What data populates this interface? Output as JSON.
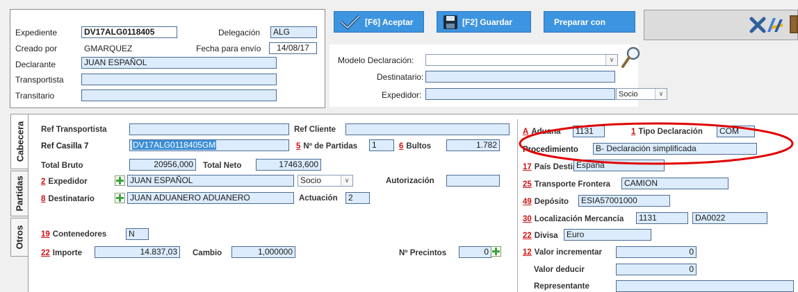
{
  "header": {
    "expediente_label": "Expediente",
    "expediente_value": "DV17ALG0118405",
    "delegacion_label": "Delegación",
    "delegacion_value": "ALG",
    "creado_label": "Creado por",
    "creado_value": "GMARQUEZ",
    "fecha_envio_label": "Fecha para envío",
    "fecha_envio_value": "14/08/17",
    "declarante_label": "Declarante",
    "declarante_value": "JUAN ESPAÑOL",
    "transportista_label": "Transportista",
    "transportista_value": "",
    "transitario_label": "Transitario",
    "transitario_value": ""
  },
  "toolbar": {
    "aceptar_label": "[F6] Aceptar",
    "guardar_label": "[F2] Guardar",
    "preparar_label": "Preparar con"
  },
  "modelo": {
    "modelo_label": "Modelo Declaración:",
    "modelo_value": "",
    "destinatario_label": "Destinatario:",
    "destinatario_value": "",
    "expedidor_label": "Expedidor:",
    "expedidor_value": "",
    "socio_value": "Socio"
  },
  "tabs": [
    "Cabecera",
    "Partidas",
    "Otros"
  ],
  "cabecera": {
    "ref_transportista_label": "Ref Transportista",
    "ref_transportista_value": "",
    "ref_cliente_label": "Ref Cliente",
    "ref_cliente_value": "",
    "ref_casilla_label": "Ref Casilla 7",
    "ref_casilla_value": "DV17ALG0118405GM",
    "partidas_num": "5",
    "partidas_label": "Nº de Partidas",
    "partidas_value": "1",
    "bultos_num": "6",
    "bultos_label": "Bultos",
    "bultos_value": "1.782",
    "total_bruto_label": "Total Bruto",
    "total_bruto_value": "20956,000",
    "total_neto_label": "Total Neto",
    "total_neto_value": "17463,600",
    "expedidor_num": "2",
    "expedidor_label": "Expedidor",
    "expedidor_value": "JUAN ESPAÑOL",
    "expedidor_socio": "Socio",
    "autorizacion_label": "Autorización",
    "autorizacion_value": "",
    "destinatario_num": "8",
    "destinatario_label": "Destinatario",
    "destinatario_value": "JUAN ADUANERO ADUANERO",
    "actuacion_label": "Actuación",
    "actuacion_value": "2",
    "contenedores_num": "19",
    "contenedores_label": "Contenedores",
    "contenedores_value": "N",
    "importe_num": "22",
    "importe_label": "Importe",
    "importe_value": "14.837,03",
    "cambio_label": "Cambio",
    "cambio_value": "1,000000",
    "precintos_label": "Nº  Precintos",
    "precintos_value": "0"
  },
  "right": {
    "aduana_num": "A",
    "aduana_label": "Aduana",
    "aduana_value": "1131",
    "tipo_num": "1",
    "tipo_label": "Tipo Declaración",
    "tipo_value": "COM",
    "procedimiento_label": "Procedimiento",
    "procedimiento_value": "B- Declaración simplificada",
    "pais_num": "17",
    "pais_label": "País Destino",
    "pais_value": "España",
    "transporte_num": "25",
    "transporte_label": "Transporte Frontera",
    "transporte_value": "CAMION",
    "deposito_num": "49",
    "deposito_label": "Depósito",
    "deposito_value": "ESIA57001000",
    "localizacion_num": "30",
    "localizacion_label": "Localización Mercancía",
    "localizacion_value1": "1131",
    "localizacion_value2": "DA0022",
    "divisa_num": "22",
    "divisa_label": "Divisa",
    "divisa_value": "Euro",
    "valor_inc_num": "12",
    "valor_inc_label": "Valor incrementar",
    "valor_inc_value": "0",
    "valor_ded_label": "Valor deducir",
    "valor_ded_value": "0",
    "representante_label": "Representante",
    "representante_value": ""
  },
  "colors": {
    "accent": "#3d94df",
    "field": "#dcecfc",
    "highlight": "#e00000",
    "label_number": "#d01010"
  }
}
